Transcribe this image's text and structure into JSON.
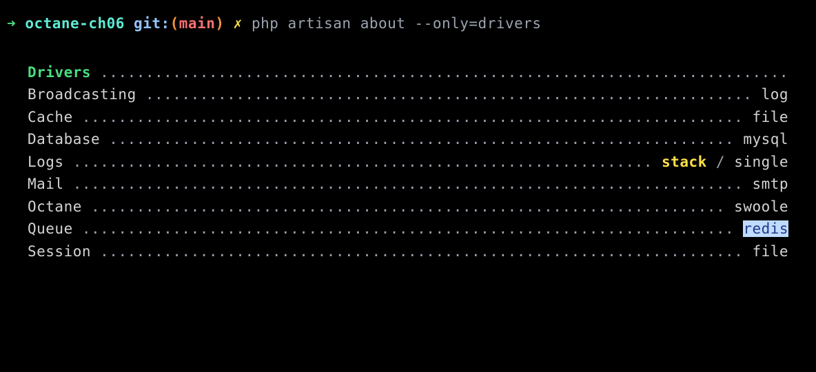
{
  "prompt": {
    "arrow": "➜",
    "dir": "octane-ch06",
    "git_label": "git:",
    "git_paren_open": "(",
    "git_branch": "main",
    "git_paren_close": ")",
    "dirty": "✗",
    "command": "php artisan about --only=drivers"
  },
  "output": {
    "section_title": "Drivers",
    "rows": [
      {
        "label": "Broadcasting",
        "value": "log",
        "style": "normal"
      },
      {
        "label": "Cache",
        "value": "file",
        "style": "normal"
      },
      {
        "label": "Database",
        "value": "mysql",
        "style": "normal"
      },
      {
        "label": "Logs",
        "value_primary": "stack",
        "value_sep": " / ",
        "value_secondary": "single",
        "style": "compound"
      },
      {
        "label": "Mail",
        "value": "smtp",
        "style": "normal"
      },
      {
        "label": "Octane",
        "value": "swoole",
        "style": "normal"
      },
      {
        "label": "Queue",
        "value": "redis",
        "style": "highlight"
      },
      {
        "label": "Session",
        "value": "file",
        "style": "normal"
      }
    ],
    "line_width": 84
  }
}
